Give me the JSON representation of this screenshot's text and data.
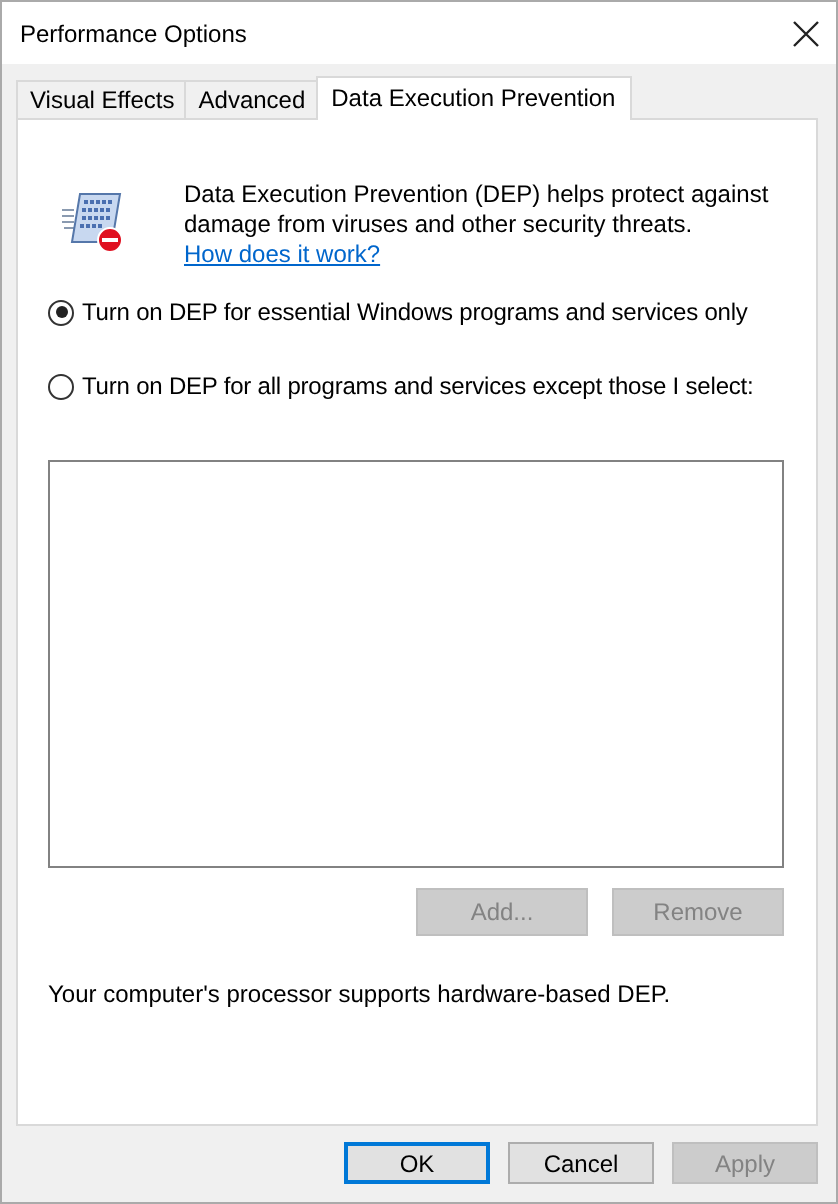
{
  "window": {
    "title": "Performance Options"
  },
  "tabs": [
    {
      "label": "Visual Effects",
      "selected": false
    },
    {
      "label": "Advanced",
      "selected": false
    },
    {
      "label": "Data Execution Prevention",
      "selected": true
    }
  ],
  "intro": {
    "text": "Data Execution Prevention (DEP) helps protect against damage from viruses and other security threats.",
    "link": "How does it work?"
  },
  "options": [
    {
      "label": "Turn on DEP for essential Windows programs and services only",
      "selected": true
    },
    {
      "label": "Turn on DEP for all programs and services except those I select:",
      "selected": false
    }
  ],
  "list_buttons": [
    {
      "label": "Add...",
      "disabled": true
    },
    {
      "label": "Remove",
      "disabled": true
    }
  ],
  "status": "Your computer's processor supports hardware-based DEP.",
  "footer_buttons": [
    {
      "label": "OK",
      "default": true,
      "disabled": false
    },
    {
      "label": "Cancel",
      "default": false,
      "disabled": false
    },
    {
      "label": "Apply",
      "default": false,
      "disabled": true
    }
  ]
}
